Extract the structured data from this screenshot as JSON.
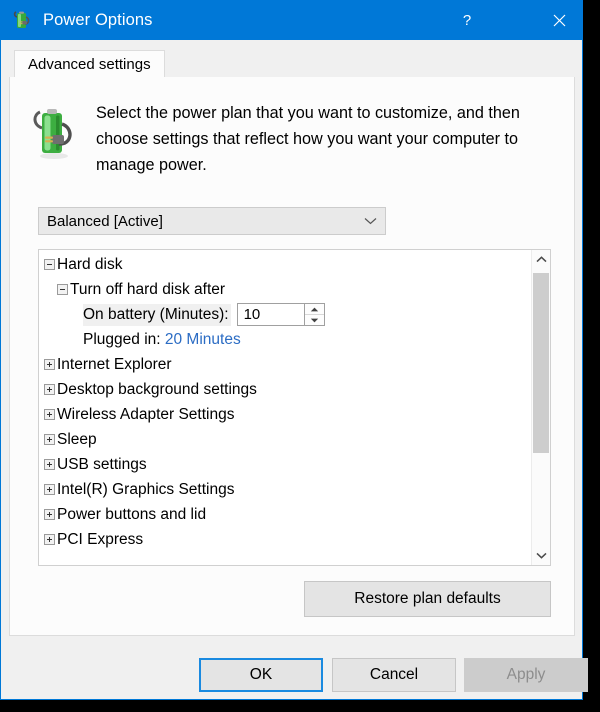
{
  "window": {
    "title": "Power Options",
    "icon": "power-plan-battery-icon",
    "help_label": "?",
    "close_label": "✕",
    "accent_color": "#0078d7"
  },
  "tabs": [
    {
      "label": "Advanced settings",
      "selected": true
    }
  ],
  "header": {
    "icon": "battery-plug-icon",
    "description": "Select the power plan that you want to customize, and then choose settings that reflect how you want your computer to manage power."
  },
  "plan_select": {
    "value": "Balanced [Active]",
    "arrow_icon": "chevron-down-icon"
  },
  "tree": {
    "items": [
      {
        "label": "Hard disk",
        "state": "expanded",
        "indent": 1,
        "type": "branch"
      },
      {
        "label": "Turn off hard disk after",
        "state": "expanded",
        "indent": 2,
        "type": "branch"
      },
      {
        "label": "On battery (Minutes):",
        "indent": 3,
        "type": "spinner",
        "value": "10",
        "shaded": true
      },
      {
        "label": "Plugged in:",
        "indent": 3,
        "type": "link",
        "value": "20 Minutes"
      },
      {
        "label": "Internet Explorer",
        "state": "collapsed",
        "indent": 1,
        "type": "branch"
      },
      {
        "label": "Desktop background settings",
        "state": "collapsed",
        "indent": 1,
        "type": "branch"
      },
      {
        "label": "Wireless Adapter Settings",
        "state": "collapsed",
        "indent": 1,
        "type": "branch"
      },
      {
        "label": "Sleep",
        "state": "collapsed",
        "indent": 1,
        "type": "branch"
      },
      {
        "label": "USB settings",
        "state": "collapsed",
        "indent": 1,
        "type": "branch"
      },
      {
        "label": "Intel(R) Graphics Settings",
        "state": "collapsed",
        "indent": 1,
        "type": "branch"
      },
      {
        "label": "Power buttons and lid",
        "state": "collapsed",
        "indent": 1,
        "type": "branch"
      },
      {
        "label": "PCI Express",
        "state": "collapsed",
        "indent": 1,
        "type": "branch"
      }
    ],
    "link_color": "#2b6cc4",
    "scrollbar": {
      "up_icon": "chevron-up-icon",
      "down_icon": "chevron-down-icon",
      "thumb_position_percent": 8,
      "thumb_size_percent": 60
    }
  },
  "restore_button": {
    "label": "Restore plan defaults"
  },
  "footer": {
    "ok_label": "OK",
    "cancel_label": "Cancel",
    "apply_label": "Apply",
    "apply_disabled": true
  }
}
